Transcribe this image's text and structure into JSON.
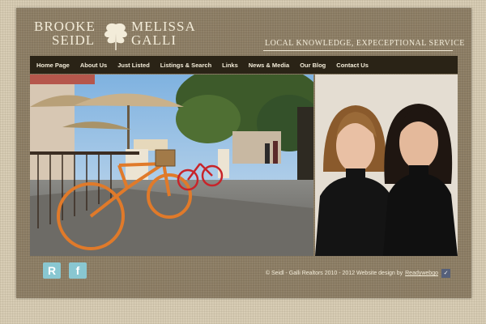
{
  "logo": {
    "first_line_left": "BROOKE",
    "second_line_left": "SEIDL",
    "first_line_right": "MELISSA",
    "second_line_right": "GALLI",
    "emblem_icon": "oak-leaf-icon"
  },
  "tagline": "LOCAL KNOWLEDGE, EXPECEPTIONAL SERVICE",
  "nav": {
    "items": [
      {
        "label": "Home Page"
      },
      {
        "label": "About Us"
      },
      {
        "label": "Just Listed"
      },
      {
        "label": "Listings & Search"
      },
      {
        "label": "Links"
      },
      {
        "label": "News & Media"
      },
      {
        "label": "Our Blog"
      },
      {
        "label": "Contact Us"
      }
    ]
  },
  "footer": {
    "social": [
      {
        "icon": "realtor-r-icon",
        "glyph": "R"
      },
      {
        "icon": "facebook-icon",
        "glyph": "f"
      }
    ],
    "copyright": "© Seidl - Galli Realtors 2010 - 2012 Website design by",
    "designer_link": "Readywebgo",
    "designer_badge_icon": "readywebgo-icon"
  },
  "colors": {
    "nav_background": "#2a2316",
    "frame": "#8c7d64",
    "social_icon": "#89c7d1"
  }
}
